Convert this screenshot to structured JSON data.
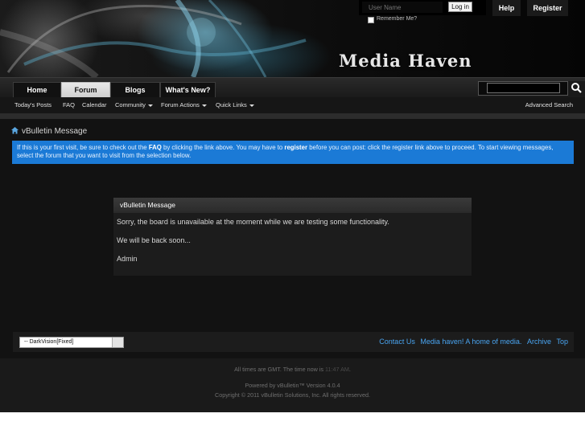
{
  "header": {
    "site_name": "Media Haven",
    "login": {
      "username_placeholder": "User Name",
      "login_label": "Log in",
      "remember_label": "Remember Me?"
    },
    "help_label": "Help",
    "register_label": "Register"
  },
  "nav": {
    "tabs": [
      {
        "label": "Home",
        "active": false
      },
      {
        "label": "Forum",
        "active": true
      },
      {
        "label": "Blogs",
        "active": false
      },
      {
        "label": "What's New?",
        "active": false
      }
    ],
    "sub_links": [
      "Today's Posts",
      "FAQ",
      "Calendar",
      "Community",
      "Forum Actions",
      "Quick Links"
    ],
    "advanced_search": "Advanced Search"
  },
  "breadcrumb": {
    "current": "vBulletin Message"
  },
  "notice": {
    "part1": "If this is your first visit, be sure to check out the ",
    "faq": "FAQ",
    "part2": " by clicking the link above. You may have to ",
    "register": "register",
    "part3": " before you can post: click the register link above to proceed. To start viewing messages, select the forum that you want to visit from the selection below."
  },
  "message": {
    "title": "vBulletin Message",
    "lines": [
      "Sorry, the board is unavailable at the moment while we are testing some functionality.",
      "We will be back soon...",
      "Admin"
    ]
  },
  "footer": {
    "style_selected": "-- DarkVision[Fixed]",
    "links": [
      "Contact Us",
      "Media haven! A home of media.",
      "Archive",
      "Top"
    ],
    "times_prefix": "All times are GMT. The time now is ",
    "time_now": "11:47 AM",
    "times_suffix": ".",
    "powered": "Powered by vBulletin™ Version 4.0.4",
    "copyright": "Copyright © 2011 vBulletin Solutions, Inc. All rights reserved."
  },
  "colors": {
    "notice_bg": "#1b7ad6",
    "link": "#49a4f0",
    "page_bg": "#121212"
  }
}
